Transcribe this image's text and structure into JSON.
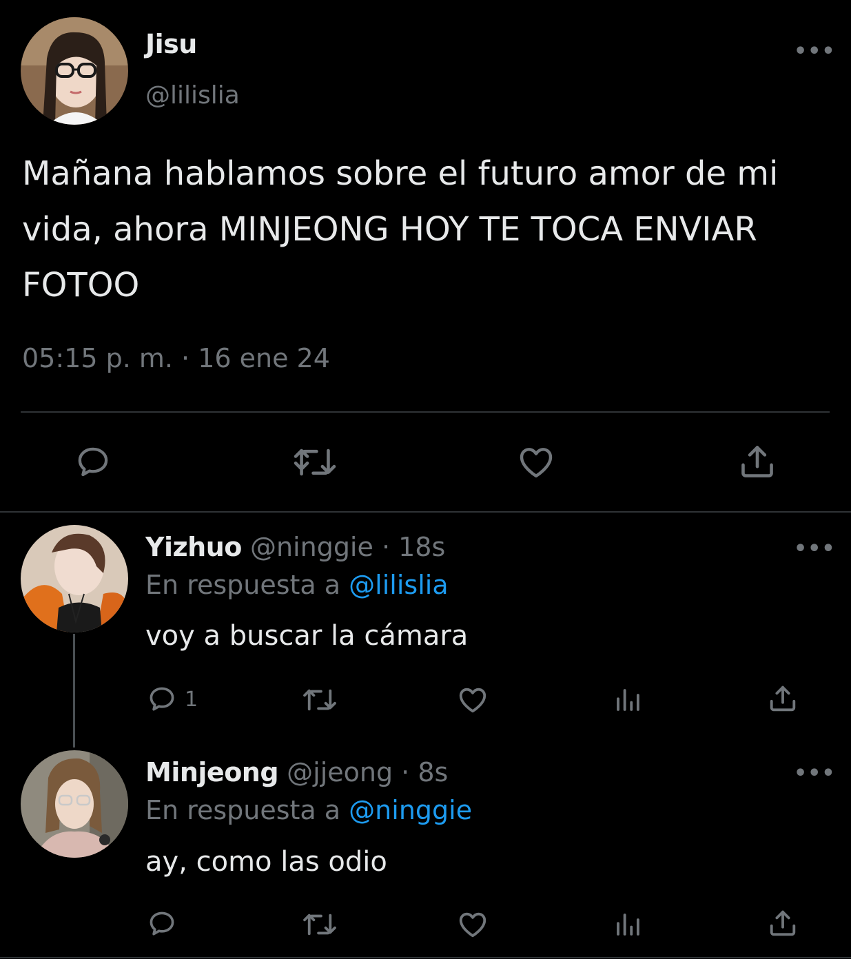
{
  "main_tweet": {
    "author_name": "Jisu",
    "author_handle": "@lilislia",
    "text": "Mañana hablamos sobre el futuro amor de mi vida, ahora MINJEONG HOY TE TOCA ENVIAR FOTOO",
    "timestamp": "05:15 p. m. · 16 ene 24",
    "more_label": "•••"
  },
  "replies": [
    {
      "author_name": "Yizhuo",
      "meta": "@ninggie · 18s",
      "reply_prefix": "En respuesta a",
      "reply_mention": "@lilislia",
      "text": "voy a buscar la cámara",
      "reply_count": "1",
      "more_label": "•••"
    },
    {
      "author_name": "Minjeong",
      "meta": "@jjeong · 8s",
      "reply_prefix": "En respuesta a",
      "reply_mention": "@ninggie",
      "text": "ay, como las odio",
      "reply_count": "",
      "more_label": "•••"
    }
  ],
  "colors": {
    "background": "#000000",
    "text_primary": "#e7e9ea",
    "text_secondary": "#71767b",
    "mention": "#1d9bf0",
    "divider": "#2f3336"
  },
  "icons": [
    "reply-icon",
    "retweet-icon",
    "like-icon",
    "views-icon",
    "share-icon",
    "more-icon"
  ]
}
